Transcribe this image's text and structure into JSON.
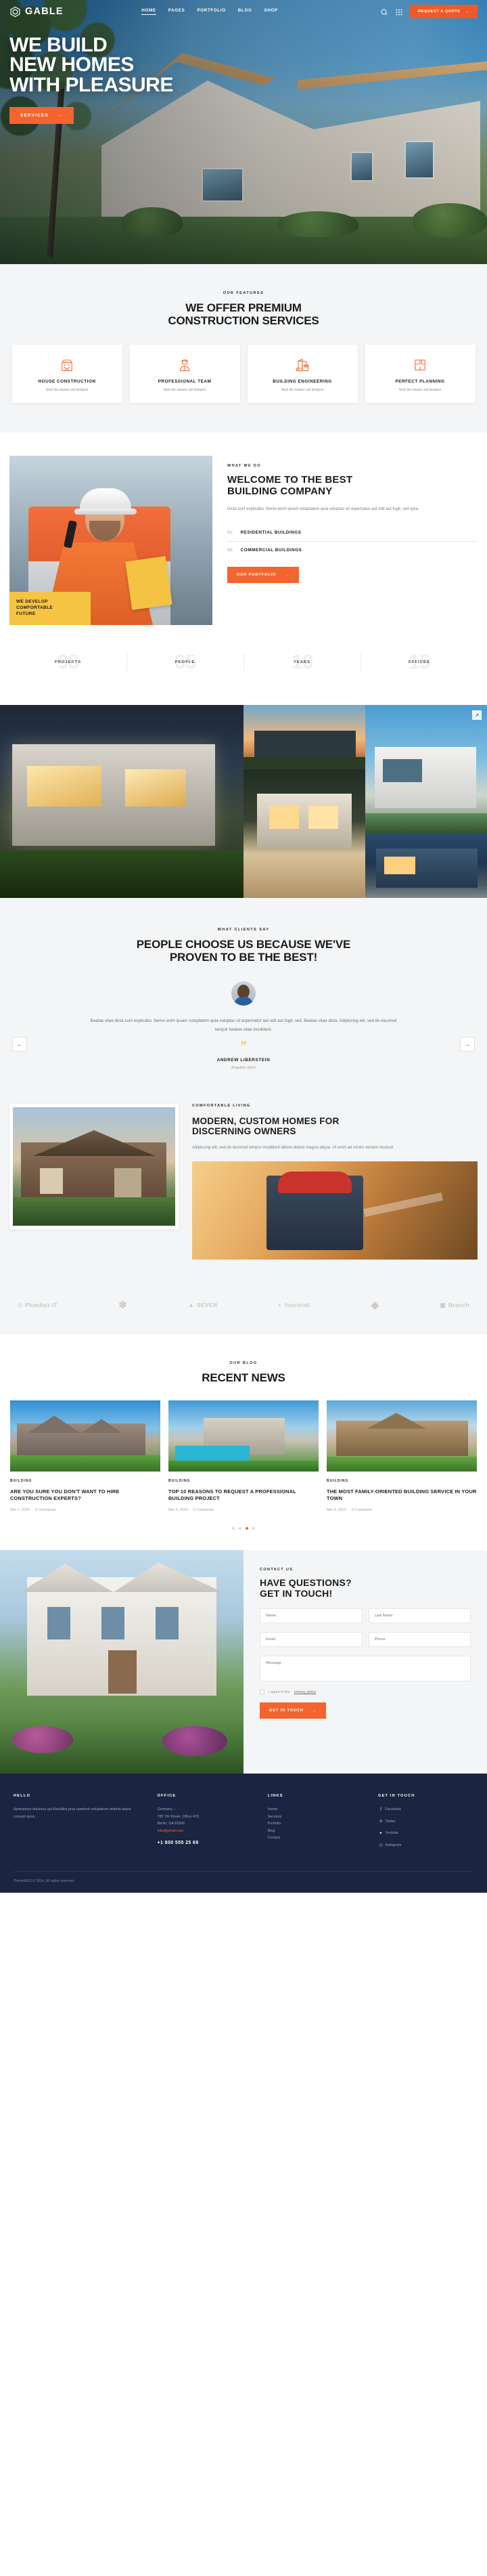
{
  "brand": {
    "name": "GABLE",
    "logo_icon": "hexagon-logo-icon"
  },
  "nav": {
    "items": [
      {
        "label": "HOME",
        "active": true
      },
      {
        "label": "PAGES",
        "active": false
      },
      {
        "label": "PORTFOLIO",
        "active": false
      },
      {
        "label": "BLOG",
        "active": false
      },
      {
        "label": "SHOP",
        "active": false
      }
    ],
    "search_icon": "search-icon",
    "grid_icon": "grid-menu-icon",
    "quote_button": "REQUEST A QUOTE"
  },
  "hero": {
    "line1": "WE BUILD",
    "line2": "NEW HOMES",
    "line3": "WITH PLEASURE",
    "cta": "SERVICES"
  },
  "features": {
    "kicker": "OUR FEATURES",
    "title_line1": "WE OFFER PREMIUM",
    "title_line2": "CONSTRUCTION SERVICES",
    "cards": [
      {
        "icon": "house-construction-icon",
        "title": "HOUSE CONSTRUCTION",
        "text": "Sed do eiusm od tempor"
      },
      {
        "icon": "professional-team-icon",
        "title": "PROFESSIONAL TEAM",
        "text": "Sed do eiusm od tempor"
      },
      {
        "icon": "building-engineering-icon",
        "title": "BUILDING ENGINEERING",
        "text": "Sed do eiusm od tempor"
      },
      {
        "icon": "perfect-planning-icon",
        "title": "PERFECT PLANNING",
        "text": "Sed do eiusm od tempor"
      }
    ]
  },
  "welcome": {
    "image_banner_line1": "WE DEVELOP",
    "image_banner_line2": "COMFORTABLE",
    "image_banner_line3": "FUTURE",
    "kicker": "WHAT WE DO",
    "title_line1": "WELCOME TO THE BEST",
    "title_line2": "BUILDING COMPANY",
    "paragraph": "Dicta sunt explicabo. Nemo enim ipsam voluptatem quia voluptas sit aspernatur aut odit aut fugit, sed quia.",
    "accordion": [
      {
        "num": "01.",
        "label": "RESIDENTIAL BUILDINGS"
      },
      {
        "num": "02.",
        "label": "COMMERCIAL BUILDINGS"
      }
    ],
    "cta": "OUR PORTFOLIO"
  },
  "counters": [
    {
      "value": "98",
      "label": "PROJECTS"
    },
    {
      "value": "65",
      "label": "PEOPLE"
    },
    {
      "value": "10",
      "label": "YEARS"
    },
    {
      "value": "15",
      "label": "OFFICES"
    }
  ],
  "portfolio": {
    "expand_icon": "expand-arrow-icon"
  },
  "testimonials": {
    "kicker": "WHAT CLIENTS SAY",
    "title_line1": "PEOPLE CHOOSE US BECAUSE WE'VE",
    "title_line2": "PROVEN TO BE THE BEST!",
    "quote": "Beatae vitae dicta sunt explicabo. Nemo enim ipsam voluptatem quia voluptas sit aspernatur aut odit aut fugit, sed. Beatae vitae dicta. Adipiscing elit, sed do eiusmod tempor beatae vitae incididunt.",
    "quote_mark": "”",
    "author": "ANDREW LIBERSTEIN",
    "role": "Regular client",
    "prev_icon": "arrow-left-icon",
    "next_icon": "arrow-right-icon"
  },
  "about": {
    "kicker": "COMFORTABLE LIVING",
    "title_line1": "MODERN, CUSTOM HOMES FOR",
    "title_line2": "DISCERNING OWNERS",
    "paragraph": "Adipiscing elit, sed do eiusmod tempor incididunt labore dolore magna aliqua. Ut enim ad minim veniam nostrud."
  },
  "partners": [
    {
      "name": "Plumbyz IT",
      "icon": "plumbyz-logo-icon"
    },
    {
      "name": "",
      "icon": "snowflake-logo-icon"
    },
    {
      "name": "SEVEN",
      "icon": "seven-logo-icon"
    },
    {
      "name": "fourmidt",
      "icon": "fourmidt-logo-icon"
    },
    {
      "name": "",
      "icon": "diamond-logo-icon"
    },
    {
      "name": "Branch",
      "icon": "branch-logo-icon"
    }
  ],
  "news": {
    "kicker": "OUR BLOG",
    "title": "RECENT NEWS",
    "cards": [
      {
        "category": "BUILDING",
        "title": "ARE YOU SURE YOU DON'T WANT TO HIRE CONSTRUCTION EXPERTS?",
        "date": "Mar 7, 2023",
        "comments": "0 Comments"
      },
      {
        "category": "BUILDING",
        "title": "TOP 10 REASONS TO REQUEST A PROFESSIONAL BUILDING PROJECT",
        "date": "Mar 6, 2023",
        "comments": "0 Comments"
      },
      {
        "category": "BUILDING",
        "title": "THE MOST FAMILY-ORIENTED BUILDING SERVICE IN YOUR TOWN",
        "date": "Mar 9, 2023",
        "comments": "0 Comments"
      }
    ],
    "dots": 4,
    "active_dot": 3
  },
  "contact": {
    "kicker": "CONTACT US",
    "title_line1": "HAVE QUESTIONS?",
    "title_line2": "GET IN TOUCH!",
    "fields": {
      "name_placeholder": "Name",
      "lastname_placeholder": "Last Name",
      "email_placeholder": "Email",
      "phone_placeholder": "Phone",
      "message_placeholder": "Message"
    },
    "consent_prefix": "I agree to the ",
    "consent_link": "privacy policy",
    "submit": "GET IN TOUCH"
  },
  "footer": {
    "about": {
      "title": "HELLO",
      "text": "Apriestines ducimus qui blanditiis pras nambod voluptatum deleniti atque corrupti quos."
    },
    "office": {
      "title": "OFFICE",
      "lines": [
        "Germany –",
        "785 7th Street, Office 478",
        "Berlin, DA 81566"
      ],
      "email": "info@gmail.com",
      "phone": "+1 800 555 25 69"
    },
    "links": {
      "title": "LINKS",
      "items": [
        "Home",
        "Services",
        "Portfolio",
        "Blog",
        "Contact"
      ]
    },
    "touch": {
      "title": "GET IN TOUCH",
      "items": [
        {
          "icon": "facebook-icon",
          "label": "Facebook"
        },
        {
          "icon": "twitter-icon",
          "label": "Twitter"
        },
        {
          "icon": "youtube-icon",
          "label": "Youtube"
        },
        {
          "icon": "instagram-icon",
          "label": "Instagram"
        }
      ]
    },
    "copyright": "ThemeREX © 2024. All rights reserved."
  },
  "colors": {
    "accent": "#f4642f",
    "dark": "#1b2440",
    "yellow": "#f5c443",
    "light": "#f4f5f6"
  }
}
